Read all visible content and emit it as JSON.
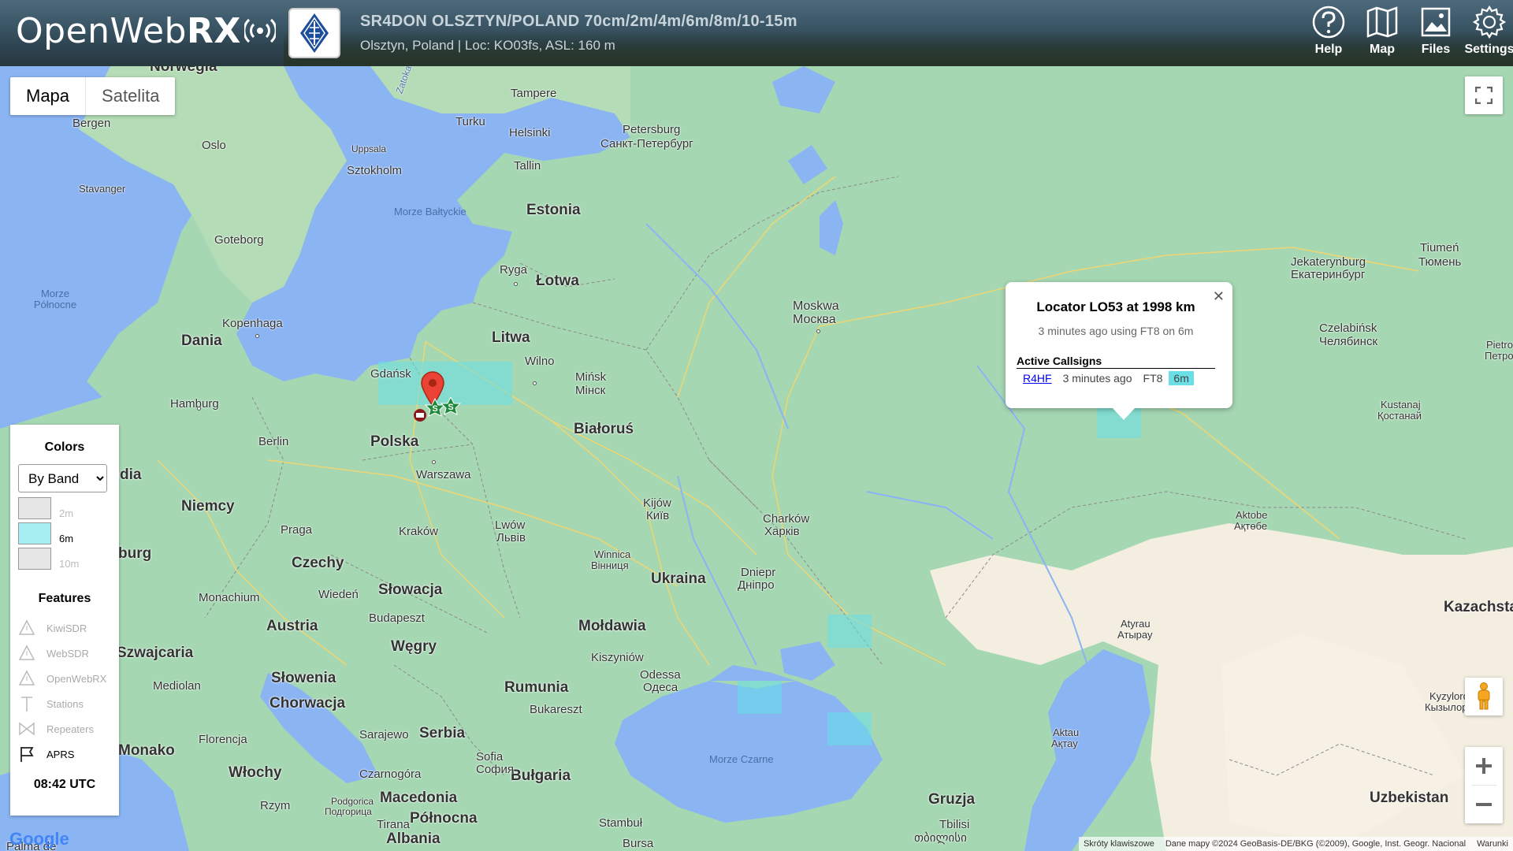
{
  "header": {
    "logo_text_light": "OpenWeb",
    "logo_text_bold": "RX",
    "receiver_title": "SR4DON OLSZTYN/POLAND 70cm/2m/4m/6m/8m/10-15m",
    "receiver_desc": "Olsztyn, Poland | Loc: KO03fs, ASL: 160 m",
    "nav": [
      {
        "label": "Help",
        "icon": "help-icon"
      },
      {
        "label": "Map",
        "icon": "map-icon"
      },
      {
        "label": "Files",
        "icon": "files-icon"
      },
      {
        "label": "Settings",
        "icon": "settings-icon"
      }
    ]
  },
  "map_type": {
    "map": "Mapa",
    "satellite": "Satelita"
  },
  "legend": {
    "colors_title": "Colors",
    "colors_select": "By Band",
    "bands": [
      {
        "label": "2m",
        "color": "#e6e6e6",
        "active": false
      },
      {
        "label": "6m",
        "color": "#a7eef2",
        "active": true
      },
      {
        "label": "10m",
        "color": "#e6e6e6",
        "active": false
      }
    ],
    "features_title": "Features",
    "features": [
      {
        "label": "KiwiSDR",
        "icon": "triangle-icon"
      },
      {
        "label": "WebSDR",
        "icon": "triangle-icon"
      },
      {
        "label": "OpenWebRX",
        "icon": "triangle-icon"
      },
      {
        "label": "Stations",
        "icon": "antenna-icon"
      },
      {
        "label": "Repeaters",
        "icon": "bowtie-icon"
      },
      {
        "label": "APRS",
        "icon": "flag-icon"
      }
    ],
    "clock": "08:42 UTC"
  },
  "popup": {
    "title": "Locator LO53 at 1998 km",
    "subtitle": "3 minutes ago using FT8 on 6m",
    "active_heading": "Active Callsigns",
    "callsigns": [
      {
        "call": "R4HF",
        "ago": "3 minutes ago",
        "mode": "FT8",
        "band": "6m"
      }
    ]
  },
  "map_labels": {
    "countries": [
      {
        "t": "Estonia"
      },
      {
        "t": "Łotwa"
      },
      {
        "t": "Litwa"
      },
      {
        "t": "Dania"
      },
      {
        "t": "Polska"
      },
      {
        "t": "Niemcy"
      },
      {
        "t": "Białoruś"
      },
      {
        "t": "Czechy"
      },
      {
        "t": "Słowacja"
      },
      {
        "t": "Austria"
      },
      {
        "t": "Węgry"
      },
      {
        "t": "Ukraina"
      },
      {
        "t": "Mołdawia"
      },
      {
        "t": "Rumunia"
      },
      {
        "t": "Słowenia"
      },
      {
        "t": "Chorwacja"
      },
      {
        "t": "Serbia"
      },
      {
        "t": "Bułgaria"
      },
      {
        "t": "Szwajcaria"
      },
      {
        "t": "Włochy"
      },
      {
        "t": "Monako"
      },
      {
        "t": "Kazachstan"
      },
      {
        "t": "Uzbekistan"
      },
      {
        "t": "Gruzja"
      },
      {
        "t": "Macedonia"
      },
      {
        "t": "Północna"
      },
      {
        "t": "Albania"
      },
      {
        "t": "Norwegia"
      }
    ],
    "cities": [
      {
        "t": "Tampere"
      },
      {
        "t": "Bergen"
      },
      {
        "t": "Turku"
      },
      {
        "t": "Helsinki"
      },
      {
        "t": "Petersburg"
      },
      {
        "t": "Санкт-Петербург"
      },
      {
        "t": "Oslo"
      },
      {
        "t": "Uppsala"
      },
      {
        "t": "Sztokholm"
      },
      {
        "t": "Tallin"
      },
      {
        "t": "Stavanger"
      },
      {
        "t": "Goteborg"
      },
      {
        "t": "Ryga"
      },
      {
        "t": "Moskwa"
      },
      {
        "t": "Москва"
      },
      {
        "t": "Jekaterynburg"
      },
      {
        "t": "Екатеринбург"
      },
      {
        "t": "Tiumeń"
      },
      {
        "t": "Тюмень"
      },
      {
        "t": "Kopenhaga"
      },
      {
        "t": "Wilno"
      },
      {
        "t": "Czelabińsk"
      },
      {
        "t": "Челябинск"
      },
      {
        "t": "Gdańsk"
      },
      {
        "t": "Mińsk"
      },
      {
        "t": "Мінск"
      },
      {
        "t": "Hamburg"
      },
      {
        "t": "Kustanaj"
      },
      {
        "t": "Қостанай"
      },
      {
        "t": "Berlin"
      },
      {
        "t": "Warszawa"
      },
      {
        "t": "Kijów"
      },
      {
        "t": "Київ"
      },
      {
        "t": "Charków"
      },
      {
        "t": "Харків"
      },
      {
        "t": "Aktobe"
      },
      {
        "t": "Ақтөбе"
      },
      {
        "t": "Praga"
      },
      {
        "t": "Kraków"
      },
      {
        "t": "Lwów"
      },
      {
        "t": "Львів"
      },
      {
        "t": "Winnica"
      },
      {
        "t": "Вінниця"
      },
      {
        "t": "Dniepr"
      },
      {
        "t": "Дніпро"
      },
      {
        "t": "Monachium"
      },
      {
        "t": "Wiedeń"
      },
      {
        "t": "Budapeszt"
      },
      {
        "t": "Kiszyniów"
      },
      {
        "t": "Odessa"
      },
      {
        "t": "Одеса"
      },
      {
        "t": "Atyrau"
      },
      {
        "t": "Атырау"
      },
      {
        "t": "Mediolan"
      },
      {
        "t": "Bukareszt"
      },
      {
        "t": "Kyzylorda"
      },
      {
        "t": "Кызылорда"
      },
      {
        "t": "Florencja"
      },
      {
        "t": "Sarajewo"
      },
      {
        "t": "Aktau"
      },
      {
        "t": "Ақтау"
      },
      {
        "t": "Czarnogóra"
      },
      {
        "t": "Sofia"
      },
      {
        "t": "София"
      },
      {
        "t": "Rzym"
      },
      {
        "t": "Tirana"
      },
      {
        "t": "Stambuł"
      },
      {
        "t": "Tbilisi"
      },
      {
        "t": "თბილისი"
      },
      {
        "t": "Bursa"
      },
      {
        "t": "Pietro"
      },
      {
        "t": "Петро"
      },
      {
        "t": "Podgorica"
      },
      {
        "t": "Подгорица"
      },
      {
        "t": "Palma de"
      },
      {
        "t": "Zatoka"
      },
      {
        "t": "burg"
      },
      {
        "t": "dia"
      }
    ],
    "seas": [
      {
        "t": "Morze Bałtyckie"
      },
      {
        "t": "Morze Północne"
      },
      {
        "t": "Morze Czarne"
      }
    ]
  },
  "footer": {
    "shortcuts": "Skróty klawiszowe",
    "mapdata": "Dane mapy ©2024 GeoBasis-DE/BKG (©2009), Google, Inst. Geogr. Nacional",
    "terms": "Warunki",
    "google": "Google"
  }
}
